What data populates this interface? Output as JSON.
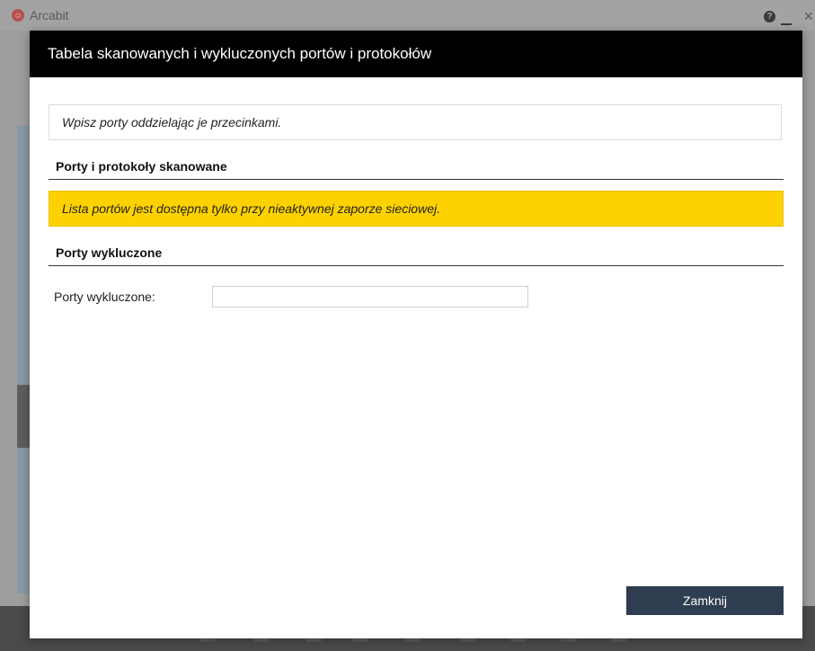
{
  "background_app": {
    "title": "Arcabit",
    "help_glyph": "?",
    "close_glyph": "×",
    "logo_glyph": "☺"
  },
  "dialog": {
    "title": "Tabela skanowanych i wykluczonych portów i protokołów",
    "hint": "Wpisz porty oddzielając je przecinkami.",
    "section_scanned": "Porty i protokoły skanowane",
    "warning": "Lista portów jest dostępna tylko przy nieaktywnej zaporze sieciowej.",
    "section_excluded": "Porty wykluczone",
    "excluded_field": {
      "label": "Porty wykluczone:",
      "value": "",
      "placeholder": ""
    },
    "close_label": "Zamknij"
  },
  "colors": {
    "header_bg": "#000000",
    "warning_bg": "#fed200",
    "button_bg": "#2e3d4f"
  }
}
